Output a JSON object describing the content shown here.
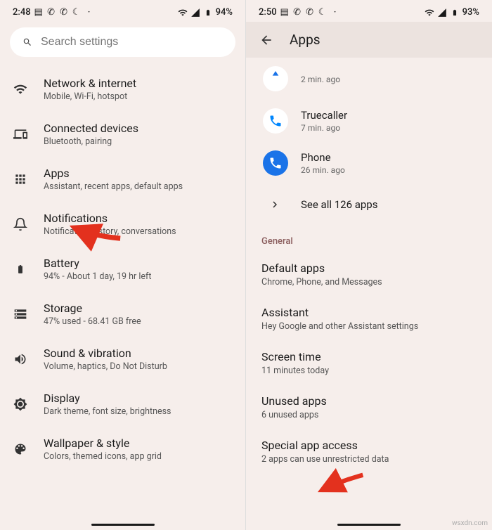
{
  "left": {
    "status": {
      "time": "2:48",
      "battery": "94%"
    },
    "search": {
      "placeholder": "Search settings"
    },
    "items": [
      {
        "title": "Network & internet",
        "sub": "Mobile, Wi-Fi, hotspot"
      },
      {
        "title": "Connected devices",
        "sub": "Bluetooth, pairing"
      },
      {
        "title": "Apps",
        "sub": "Assistant, recent apps, default apps"
      },
      {
        "title": "Notifications",
        "sub": "Notification history, conversations"
      },
      {
        "title": "Battery",
        "sub": "94% - About 1 day, 19 hr left"
      },
      {
        "title": "Storage",
        "sub": "47% used - 68.41 GB free"
      },
      {
        "title": "Sound & vibration",
        "sub": "Volume, haptics, Do Not Disturb"
      },
      {
        "title": "Display",
        "sub": "Dark theme, font size, brightness"
      },
      {
        "title": "Wallpaper & style",
        "sub": "Colors, themed icons, app grid"
      }
    ]
  },
  "right": {
    "status": {
      "time": "2:50",
      "battery": "93%"
    },
    "header": {
      "title": "Apps"
    },
    "recent": [
      {
        "name": "",
        "sub": "2 min. ago"
      },
      {
        "name": "Truecaller",
        "sub": "7 min. ago"
      },
      {
        "name": "Phone",
        "sub": "26 min. ago"
      }
    ],
    "see_all": "See all 126 apps",
    "section": "General",
    "general": [
      {
        "title": "Default apps",
        "sub": "Chrome, Phone, and Messages"
      },
      {
        "title": "Assistant",
        "sub": "Hey Google and other Assistant settings"
      },
      {
        "title": "Screen time",
        "sub": "11 minutes today"
      },
      {
        "title": "Unused apps",
        "sub": "6 unused apps"
      },
      {
        "title": "Special app access",
        "sub": "2 apps can use unrestricted data"
      }
    ]
  },
  "watermark": "wsxdn.com"
}
